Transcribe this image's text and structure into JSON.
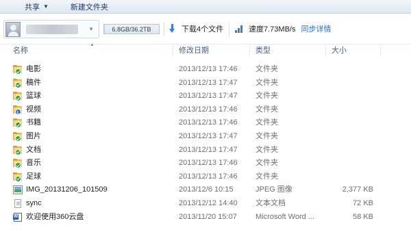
{
  "toolbar": {
    "share_label": "共享",
    "new_folder_label": "新建文件夹"
  },
  "status": {
    "quota_text": "6.8GB/36.2TB",
    "quota_used_fraction": 0.0002,
    "download_text": "下载4个文件",
    "speed_text": "速度7.73MB/s",
    "sync_link_text": "同步详情"
  },
  "columns": {
    "name": "名称",
    "date": "修改日期",
    "type": "类型",
    "size": "大小"
  },
  "files": [
    {
      "name": "电影",
      "date": "2013/12/13 17:46",
      "type": "文件夹",
      "size": "",
      "icon": "folder-synced-icon"
    },
    {
      "name": "稿件",
      "date": "2013/12/13 17:47",
      "type": "文件夹",
      "size": "",
      "icon": "folder-synced-icon"
    },
    {
      "name": "篮球",
      "date": "2013/12/13 17:47",
      "type": "文件夹",
      "size": "",
      "icon": "folder-synced-icon"
    },
    {
      "name": "视频",
      "date": "2013/12/13 17:46",
      "type": "文件夹",
      "size": "",
      "icon": "folder-syncing-icon"
    },
    {
      "name": "书籍",
      "date": "2013/12/13 17:46",
      "type": "文件夹",
      "size": "",
      "icon": "folder-synced-icon"
    },
    {
      "name": "图片",
      "date": "2013/12/13 17:47",
      "type": "文件夹",
      "size": "",
      "icon": "folder-synced-icon"
    },
    {
      "name": "文档",
      "date": "2013/12/13 17:47",
      "type": "文件夹",
      "size": "",
      "icon": "folder-synced-icon"
    },
    {
      "name": "音乐",
      "date": "2013/12/13 17:46",
      "type": "文件夹",
      "size": "",
      "icon": "folder-synced-icon"
    },
    {
      "name": "足球",
      "date": "2013/12/13 17:46",
      "type": "文件夹",
      "size": "",
      "icon": "folder-synced-icon"
    },
    {
      "name": "IMG_20131206_101509",
      "date": "2013/12/6 10:15",
      "type": "JPEG 图像",
      "size": "2,377 KB",
      "icon": "image-file-icon"
    },
    {
      "name": "sync",
      "date": "2013/12/12 14:40",
      "type": "文本文档",
      "size": "72 KB",
      "icon": "text-file-icon"
    },
    {
      "name": "欢迎使用360云盘",
      "date": "2013/11/20 15:07",
      "type": "Microsoft Word ...",
      "size": "58 KB",
      "icon": "word-doc-icon"
    }
  ]
}
